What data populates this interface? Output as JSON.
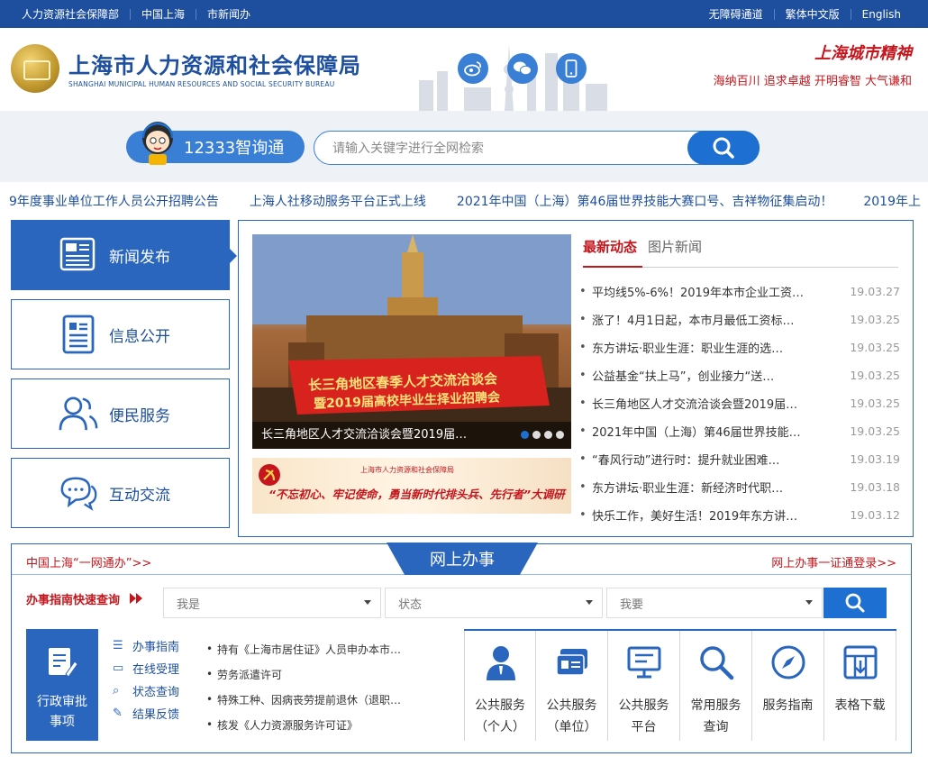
{
  "topbar": {
    "left": [
      "人力资源社会保障部",
      "中国上海",
      "市新闻办"
    ],
    "right": [
      "无障碍通道",
      "繁体中文版",
      "English"
    ]
  },
  "header": {
    "title": "上海市人力资源和社会保障局",
    "subtitle": "SHANGHAI MUNICIPAL HUMAN RESOURCES AND SOCIAL SECURITY BUREAU",
    "spirit_title": "上海城市精神",
    "spirit_text": "海纳百川  追求卓越  开明睿智  大气谦和"
  },
  "search": {
    "zhixuntong": "12333智询通",
    "placeholder": "请输入关键字进行全网检索"
  },
  "ticker": [
    "9年度事业单位工作人员公开招聘公告",
    "上海人社移动服务平台正式上线",
    "2021年中国（上海）第46届世界技能大赛口号、吉祥物征集启动！",
    "2019年上"
  ],
  "leftnav": [
    "新闻发布",
    "信息公开",
    "便民服务",
    "互动交流"
  ],
  "news": {
    "main_image_caption": "长三角地区人才交流洽谈会暨2019届…",
    "main_image_banner_line1": "长三角地区春季人才交流洽谈会",
    "main_image_banner_line2": "暨2019届高校毕业生择业招聘会",
    "banner2_small": "上海市人力资源和社会保障局",
    "banner2_main": "“不忘初心、牢记使命，勇当新时代排头兵、先行者”大调研",
    "tabs": [
      "最新动态",
      "图片新闻"
    ],
    "items": [
      {
        "title": "平均线5%-6%！2019年本市企业工资…",
        "date": "19.03.27"
      },
      {
        "title": "涨了！4月1日起，本市月最低工资标…",
        "date": "19.03.25"
      },
      {
        "title": "东方讲坛·职业生涯：职业生涯的选…",
        "date": "19.03.25"
      },
      {
        "title": "公益基金“扶上马”，创业接力“送…",
        "date": "19.03.25"
      },
      {
        "title": "长三角地区人才交流洽谈会暨2019届…",
        "date": "19.03.25"
      },
      {
        "title": "2021年中国（上海）第46届世界技能…",
        "date": "19.03.25"
      },
      {
        "title": "“春风行动”进行时：提升就业困难…",
        "date": "19.03.19"
      },
      {
        "title": "东方讲坛·职业生涯：新经济时代职…",
        "date": "19.03.18"
      },
      {
        "title": "快乐工作，美好生活！2019年东方讲…",
        "date": "19.03.12"
      }
    ]
  },
  "online": {
    "title": "网上办事",
    "left_link": "中国上海“一网通办”>>",
    "right_link": "网上办事一证通登录>>",
    "quick_label": "办事指南快速查询",
    "selects": [
      "我是",
      "状态",
      "我要"
    ],
    "admin_label_1": "行政审批",
    "admin_label_2": "事项",
    "admin_links": [
      "办事指南",
      "在线受理",
      "状态查询",
      "结果反馈"
    ],
    "admin_items": [
      "持有《上海市居住证》人员申办本市…",
      "劳务派遣许可",
      "特殊工种、因病丧劳提前退休（退职…",
      "核发《人力资源服务许可证》"
    ],
    "services": [
      {
        "l1": "公共服务",
        "l2": "（个人）"
      },
      {
        "l1": "公共服务",
        "l2": "（单位）"
      },
      {
        "l1": "公共服务",
        "l2": "平台"
      },
      {
        "l1": "常用服务",
        "l2": "查询"
      },
      {
        "l1": "服务指南",
        "l2": ""
      },
      {
        "l1": "表格下载",
        "l2": ""
      }
    ]
  },
  "colors": {
    "brand_blue": "#1d4f9e",
    "accent_blue": "#2a66bd",
    "red": "#c4161c"
  }
}
